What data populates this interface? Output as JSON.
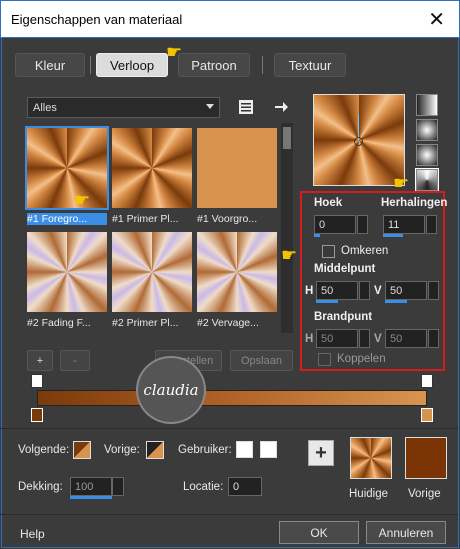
{
  "window": {
    "title": "Eigenschappen van materiaal",
    "close_glyph": "✕"
  },
  "tabs": [
    {
      "label": "Kleur",
      "active": false
    },
    {
      "label": "Verloop",
      "active": true
    },
    {
      "label": "Patroon",
      "active": false
    },
    {
      "label": "Textuur",
      "active": false
    }
  ],
  "category": {
    "selected": "Alles"
  },
  "gradients": [
    {
      "caption": "#1 Foregro...",
      "style": "sun",
      "selected": true
    },
    {
      "caption": "#1 Primer Pl...",
      "style": "sun",
      "selected": false
    },
    {
      "caption": "#1 Voorgro...",
      "style": "solid",
      "selected": false
    },
    {
      "caption": "#2 Fading F...",
      "style": "fade",
      "selected": false
    },
    {
      "caption": "#2 Primer Pl...",
      "style": "fade",
      "selected": false
    },
    {
      "caption": "#2 Vervage...",
      "style": "fade",
      "selected": false
    }
  ],
  "list_buttons": {
    "add": "+",
    "remove": "-",
    "restore": "Herstellen",
    "save": "Opslaan"
  },
  "settings": {
    "angle_label": "Hoek",
    "angle_value": "0",
    "repeats_label": "Herhalingen",
    "repeats_value": "11",
    "invert_label": "Omkeren",
    "center_label": "Middelpunt",
    "center_h_label": "H",
    "center_h": "50",
    "center_v_label": "V",
    "center_v": "50",
    "focal_label": "Brandpunt",
    "focal_h_label": "H",
    "focal_h": "50",
    "focal_v_label": "V",
    "focal_v": "50",
    "link_label": "Koppelen"
  },
  "watermark": {
    "text": "claudia"
  },
  "bottom": {
    "next_label": "Volgende:",
    "prev_label": "Vorige:",
    "user_label": "Gebruiker:",
    "opacity_label": "Dekking:",
    "opacity_value": "100",
    "location_label": "Locatie:",
    "location_value": "0",
    "current_label": "Huidige",
    "previous_label": "Vorige",
    "plus": "+"
  },
  "footer": {
    "help": "Help",
    "ok": "OK",
    "cancel": "Annuleren"
  },
  "colors": {
    "accent": "#3a8ee6",
    "highlight_box": "#d21e1e",
    "previous_swatch": "#7b3505",
    "bar_dark": "#7a3a0a",
    "bar_light": "#d8944f"
  },
  "icons": [
    "close-icon",
    "list-view-icon",
    "arrow-right-icon",
    "pointing-hand-icon",
    "spin-arrow-icon"
  ]
}
